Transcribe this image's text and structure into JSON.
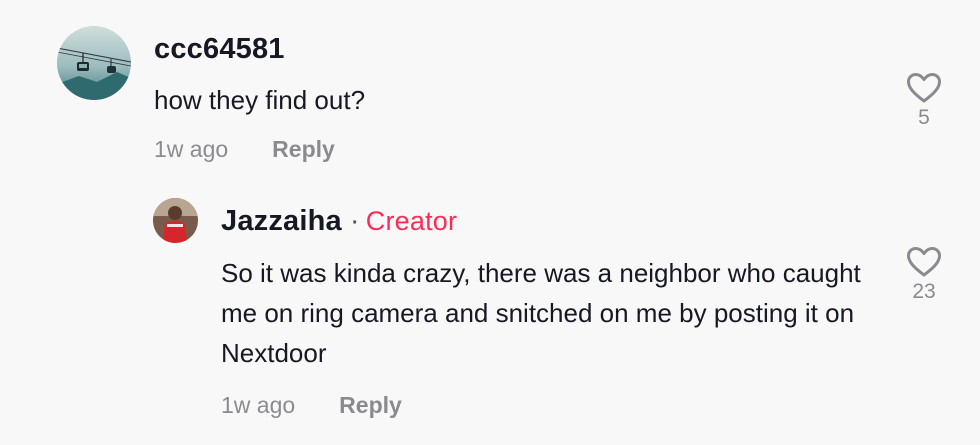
{
  "comments": [
    {
      "username": "ccc64581",
      "text": "how they find out?",
      "time": "1w ago",
      "reply_label": "Reply",
      "likes": "5"
    }
  ],
  "replies": [
    {
      "username": "Jazzaiha",
      "separator": "·",
      "badge": "Creator",
      "text": "So it was kinda crazy, there was a neighbor who caught me on ring camera and snitched on me by posting it on Nextdoor",
      "time": "1w ago",
      "reply_label": "Reply",
      "likes": "23"
    }
  ],
  "colors": {
    "background": "#f8f8f8",
    "text": "#161823",
    "muted": "#8a8b91",
    "creator_badge": "#fe2c55"
  },
  "icons": {
    "like": "heart-outline-icon"
  }
}
